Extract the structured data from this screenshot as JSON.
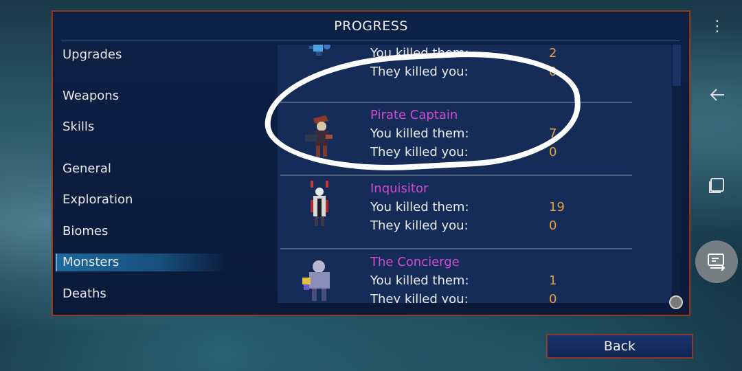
{
  "panel": {
    "title": "PROGRESS"
  },
  "menu": {
    "items": [
      {
        "label": "Upgrades",
        "active": false
      },
      {
        "label": "Weapons",
        "active": false
      },
      {
        "label": "Skills",
        "active": false
      },
      {
        "label": "General",
        "active": false
      },
      {
        "label": "Exploration",
        "active": false
      },
      {
        "label": "Biomes",
        "active": false
      },
      {
        "label": "Monsters",
        "active": true
      },
      {
        "label": "Deaths",
        "active": false
      }
    ]
  },
  "monsters": {
    "partial_top": {
      "killed_label": "You killed them:",
      "killed_value": "2",
      "died_label": "They killed you:",
      "died_value": "0"
    },
    "entries": [
      {
        "name": "Pirate Captain",
        "killed_label": "You killed them:",
        "killed_value": "7",
        "died_label": "They killed you:",
        "died_value": "0"
      },
      {
        "name": "Inquisitor",
        "killed_label": "You killed them:",
        "killed_value": "19",
        "died_label": "They killed you:",
        "died_value": "0"
      },
      {
        "name": "The Concierge",
        "killed_label": "You killed them:",
        "killed_value": "1",
        "died_label": "They killed you:",
        "died_value": "0"
      }
    ]
  },
  "footer": {
    "back_label": "Back"
  },
  "system_nav": {
    "menu_icon": "three-dots-vertical-icon",
    "back_icon": "arrow-left-icon",
    "recents_icon": "square-icon",
    "floating_icon": "screen-record-icon"
  },
  "colors": {
    "monster_name": "#d34bd3",
    "stat_value": "#e8a040",
    "panel_border": "#8b3a2e"
  }
}
